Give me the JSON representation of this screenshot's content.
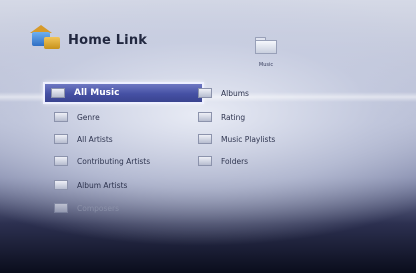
{
  "app": {
    "title": "Home Link",
    "category_label": "Music"
  },
  "menu": {
    "left": [
      {
        "label": "All Music",
        "state": "selected"
      },
      {
        "label": "Genre",
        "state": "normal"
      },
      {
        "label": "All Artists",
        "state": "normal"
      },
      {
        "label": "Contributing Artists",
        "state": "normal"
      },
      {
        "label": "Album Artists",
        "state": "normal"
      },
      {
        "label": "Composers",
        "state": "faded"
      }
    ],
    "right": [
      {
        "label": "Albums"
      },
      {
        "label": "Rating"
      },
      {
        "label": "Music Playlists"
      },
      {
        "label": "Folders"
      }
    ]
  },
  "colors": {
    "selection": "#4550a4",
    "text": "#2e344f",
    "background_dark": "#0a0d1c"
  }
}
